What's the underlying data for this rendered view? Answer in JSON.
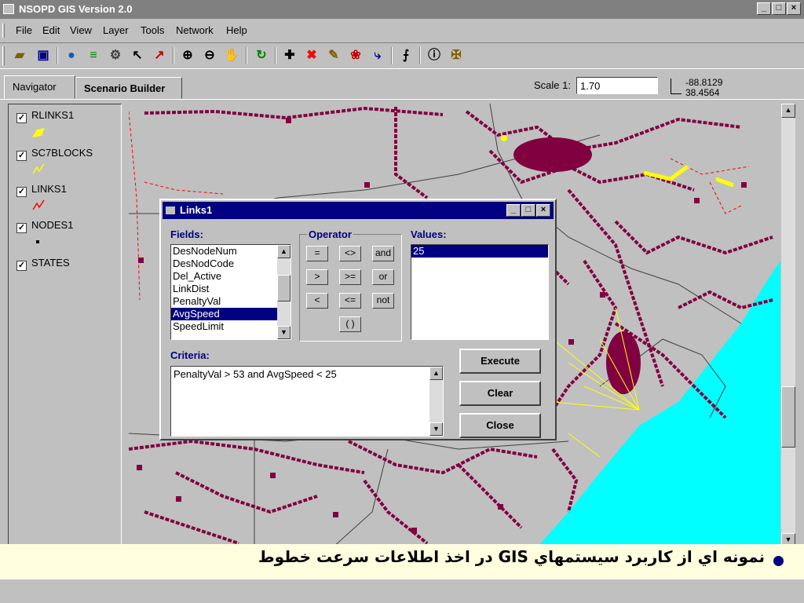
{
  "window": {
    "title": "NSOPD GIS Version 2.0",
    "min": "_",
    "max": "□",
    "close": "×"
  },
  "menu": [
    "File",
    "Edit",
    "View",
    "Layer",
    "Tools",
    "Network",
    "Help"
  ],
  "toolbar": {
    "icons": [
      "open-folder-icon",
      "save-icon",
      "globe-icon",
      "add-layer-icon",
      "layer-properties-icon",
      "select-arrow-icon",
      "pointer-icon",
      "zoom-in-icon",
      "zoom-out-icon",
      "pan-hand-icon",
      "refresh-icon",
      "add-point-icon",
      "delete-icon",
      "edit-icon",
      "network-icon",
      "route-icon",
      "graph-icon",
      "info-icon",
      "crosshair-icon"
    ],
    "glyphs": [
      "▰",
      "▣",
      "●",
      "≡",
      "⚙",
      "↖",
      "↗",
      "⊕",
      "⊖",
      "✋",
      "↻",
      "✚",
      "✖",
      "✎",
      "❀",
      "⤷",
      "⨍",
      "ⓘ",
      "✠"
    ]
  },
  "tabs": {
    "navigator": "Navigator",
    "scenario_builder": "Scenario Builder"
  },
  "scale": {
    "label": "Scale 1:",
    "value": "1.70"
  },
  "coords": {
    "x": "-88.8129",
    "y": "38.4564"
  },
  "layers": [
    {
      "name": "RLINKS1",
      "checked": "✓",
      "color": "#ffff00"
    },
    {
      "name": "SC7BLOCKS",
      "checked": "✓",
      "color": "#ffff00"
    },
    {
      "name": "LINKS1",
      "checked": "✓",
      "color": "#ff0000"
    },
    {
      "name": "NODES1",
      "checked": "✓",
      "color": "#000000"
    },
    {
      "name": "STATES",
      "checked": "✓",
      "color": "#c0c0c0"
    }
  ],
  "dialog": {
    "title": "Links1",
    "fields_label": "Fields:",
    "fields": [
      "DesNodeNum",
      "DesNodCode",
      "Del_Active",
      "LinkDist",
      "PenaltyVal",
      "AvgSpeed",
      "SpeedLimit"
    ],
    "selected_field": "AvgSpeed",
    "operator_label": "Operator",
    "operators": [
      "=",
      "<>",
      "and",
      ">",
      ">=",
      "or",
      "<",
      "<=",
      "not",
      "( )"
    ],
    "values_label": "Values:",
    "values": [
      "25"
    ],
    "criteria_label": "Criteria:",
    "criteria": "PenaltyVal > 53 and AvgSpeed < 25",
    "execute": "Execute",
    "clear": "Clear",
    "close": "Close"
  },
  "caption": "نمونه اي از كاربرد سيستمهاي GIS در اخذ اطلاعات سرعت خطوط",
  "colors": {
    "ocean": "#00ffff",
    "network": "#800040",
    "highlight": "#ffff00",
    "link": "#ff0000"
  }
}
